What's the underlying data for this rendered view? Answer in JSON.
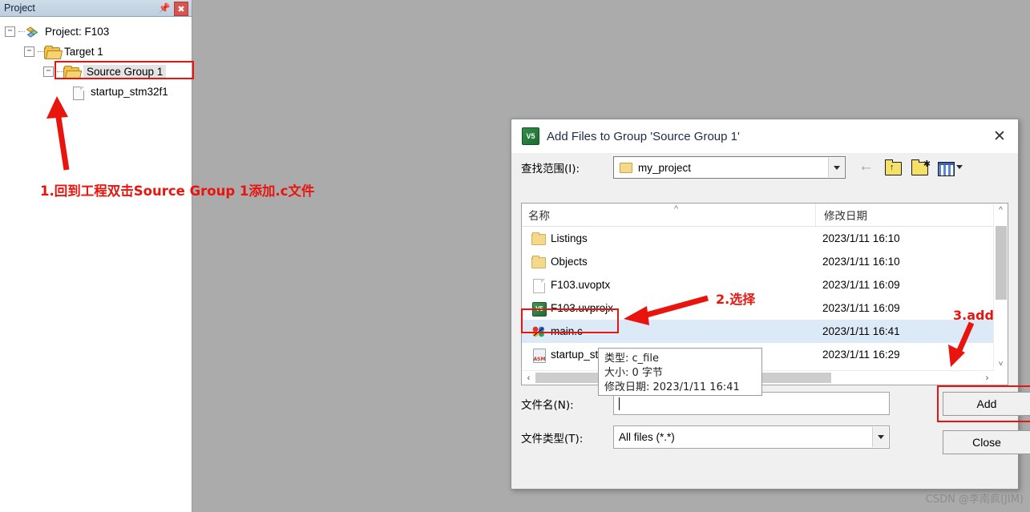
{
  "project_pane": {
    "title": "Project",
    "pin_icon": "pin-icon",
    "close_icon": "close-icon",
    "tree": [
      {
        "label": "Project: F103",
        "level": 0,
        "icon": "project-icon",
        "expander": "-"
      },
      {
        "label": "Target 1",
        "level": 1,
        "icon": "target-folder-icon",
        "expander": "-"
      },
      {
        "label": "Source Group 1",
        "level": 2,
        "icon": "folder-open-icon",
        "expander": "-",
        "selected": true
      },
      {
        "label": "startup_stm32f1",
        "level": 3,
        "icon": "document-icon",
        "expander": ""
      }
    ]
  },
  "annotations": {
    "note1": "1.回到工程双击Source Group 1添加.c文件",
    "note2": "2.选择",
    "note3": "3.add",
    "accent_color": "#e8140d"
  },
  "dialog": {
    "title": "Add Files to Group 'Source Group 1'",
    "app_icon_text": "V5",
    "close_icon": "close-icon",
    "lookin": {
      "label": "查找范围(I):",
      "value": "my_project",
      "dropdown_icon": "chevron-down-icon"
    },
    "toolbar_icons": [
      "back-arrow-icon",
      "up-one-level-icon",
      "new-folder-icon",
      "views-dropdown-icon"
    ],
    "file_list": {
      "columns": [
        "名称",
        "修改日期"
      ],
      "sort_indicator": "sort-ascending-icon",
      "rows": [
        {
          "icon": "folder-icon",
          "name": "Listings",
          "date": "2023/1/11 16:10",
          "selected": false
        },
        {
          "icon": "folder-icon",
          "name": "Objects",
          "date": "2023/1/11 16:10",
          "selected": false
        },
        {
          "icon": "file-icon",
          "name": "F103.uvoptx",
          "date": "2023/1/11 16:09",
          "selected": false
        },
        {
          "icon": "uvision-icon",
          "name": "F103.uvprojx",
          "date": "2023/1/11 16:09",
          "selected": false
        },
        {
          "icon": "c-source-icon",
          "name": "main.c",
          "date": "2023/1/11 16:41",
          "selected": true
        },
        {
          "icon": "asm-file-icon",
          "name": "startup_stm32f1",
          "date": "2023/1/11 16:29",
          "selected": false
        }
      ]
    },
    "tooltip": {
      "type": "类型: c_file",
      "size": "大小: 0 字节",
      "modified": "修改日期: 2023/1/11 16:41"
    },
    "filename": {
      "label": "文件名(N):",
      "value": "",
      "placeholder": ""
    },
    "filetype": {
      "label": "文件类型(T):",
      "value": "All files (*.*)",
      "dropdown_icon": "chevron-down-icon"
    },
    "buttons": {
      "add": "Add",
      "close": "Close"
    }
  },
  "watermark": "CSDN @李南疯(JIM)"
}
